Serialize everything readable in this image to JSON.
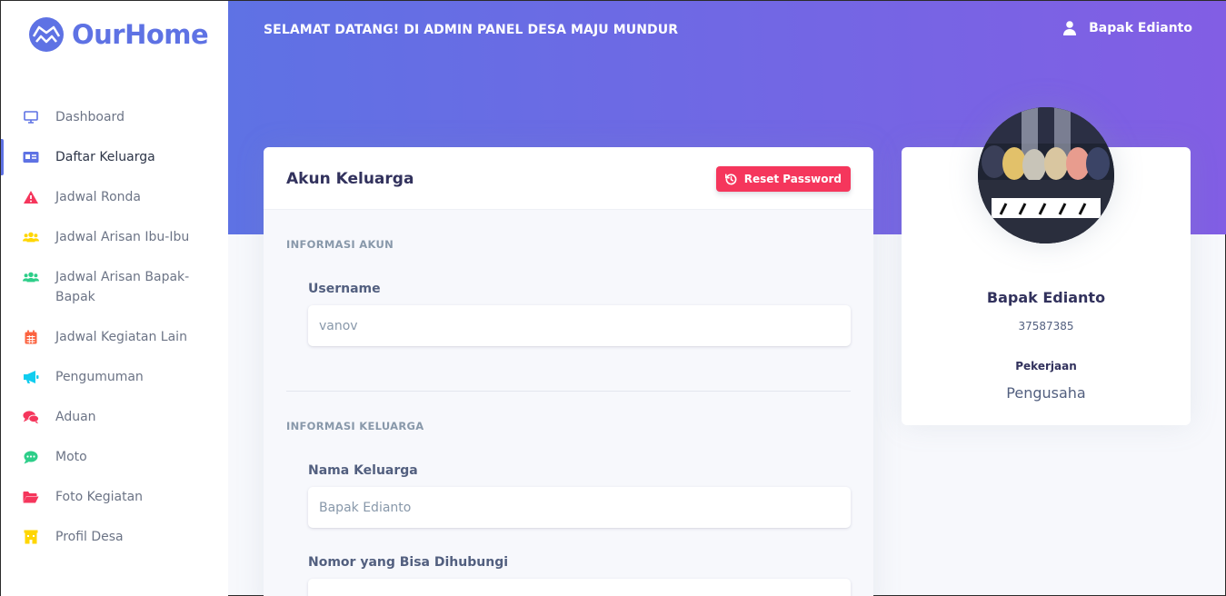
{
  "brand": {
    "name": "OurHome",
    "color": "#5e72e4"
  },
  "header": {
    "welcome": "SELAMAT DATANG! DI ADMIN PANEL DESA MAJU MUNDUR",
    "user_name": "Bapak Edianto",
    "user_icon": "user-icon",
    "gradient": [
      "#5e72e4",
      "#825ee4"
    ]
  },
  "sidebar": {
    "items": [
      {
        "label": "Dashboard",
        "icon": "monitor-icon",
        "color": "#5e72e4",
        "active": false
      },
      {
        "label": "Daftar Keluarga",
        "icon": "id-card-icon",
        "color": "#5e72e4",
        "active": true
      },
      {
        "label": "Jadwal Ronda",
        "icon": "warning-icon",
        "color": "#f5365c",
        "active": false
      },
      {
        "label": "Jadwal Arisan Ibu-Ibu",
        "icon": "users-icon",
        "color": "#ffd600",
        "active": false
      },
      {
        "label": "Jadwal Arisan Bapak-Bapak",
        "icon": "users-icon",
        "color": "#2dce89",
        "active": false
      },
      {
        "label": "Jadwal Kegiatan Lain",
        "icon": "calendar-icon",
        "color": "#fb6340",
        "active": false
      },
      {
        "label": "Pengumuman",
        "icon": "megaphone-icon",
        "color": "#11cdef",
        "active": false
      },
      {
        "label": "Aduan",
        "icon": "comments-icon",
        "color": "#f5365c",
        "active": false
      },
      {
        "label": "Moto",
        "icon": "comment-dots-icon",
        "color": "#2dce89",
        "active": false
      },
      {
        "label": "Foto Kegiatan",
        "icon": "folder-open-icon",
        "color": "#f5365c",
        "active": false
      },
      {
        "label": "Profil Desa",
        "icon": "building-icon",
        "color": "#ffd600",
        "active": false
      }
    ]
  },
  "card": {
    "title": "Akun Keluarga",
    "reset_button": "Reset Password",
    "reset_icon": "history-icon",
    "sections": {
      "account": "INFORMASI AKUN",
      "family": "INFORMASI KELUARGA"
    },
    "fields": {
      "username": {
        "label": "Username",
        "value": "vanov"
      },
      "family_name": {
        "label": "Nama Keluarga",
        "value": "Bapak Edianto"
      },
      "phone": {
        "label": "Nomor yang Bisa Dihubungi",
        "value": ""
      }
    }
  },
  "profile": {
    "name": "Bapak Edianto",
    "id_number": "37587385",
    "job_label": "Pekerjaan",
    "job": "Pengusaha"
  }
}
